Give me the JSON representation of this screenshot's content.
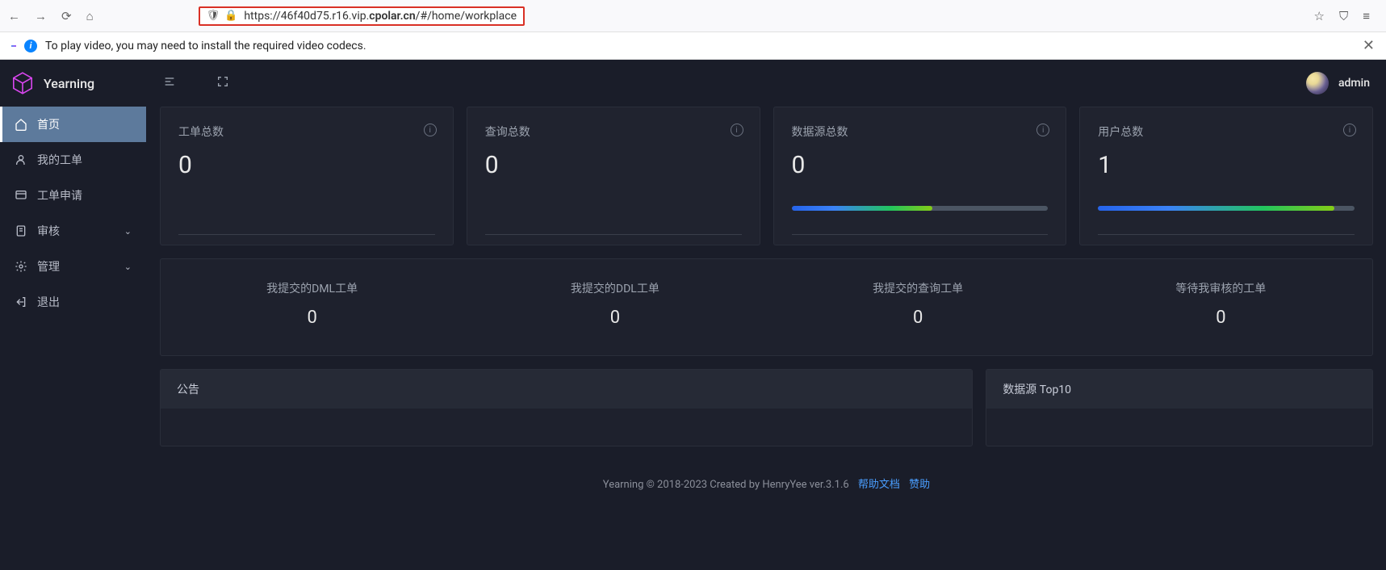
{
  "browser": {
    "url_prefix": "https://46f40d75.r16.vip.",
    "url_bold": "cpolar.cn",
    "url_suffix": "/#/home/workplace",
    "notification": "To play video, you may need to install the required video codecs."
  },
  "app": {
    "name": "Yearning",
    "username": "admin"
  },
  "sidebar": {
    "items": [
      {
        "label": "首页",
        "icon": "home",
        "active": true
      },
      {
        "label": "我的工单",
        "icon": "user",
        "active": false
      },
      {
        "label": "工单申请",
        "icon": "terminal",
        "active": false
      },
      {
        "label": "审核",
        "icon": "clipboard",
        "active": false,
        "expandable": true
      },
      {
        "label": "管理",
        "icon": "gear",
        "active": false,
        "expandable": true
      },
      {
        "label": "退出",
        "icon": "logout",
        "active": false
      }
    ]
  },
  "stats": [
    {
      "title": "工单总数",
      "value": "0",
      "has_bar": false
    },
    {
      "title": "查询总数",
      "value": "0",
      "has_bar": false
    },
    {
      "title": "数据源总数",
      "value": "0",
      "has_bar": true,
      "bar_pct": 55
    },
    {
      "title": "用户总数",
      "value": "1",
      "has_bar": true,
      "bar_pct": 92
    }
  ],
  "substats": [
    {
      "label": "我提交的DML工单",
      "value": "0"
    },
    {
      "label": "我提交的DDL工单",
      "value": "0"
    },
    {
      "label": "我提交的查询工单",
      "value": "0"
    },
    {
      "label": "等待我审核的工单",
      "value": "0"
    }
  ],
  "panels": {
    "announce": "公告",
    "top10": "数据源 Top10"
  },
  "footer": {
    "text": "Yearning © 2018-2023 Created by HenryYee ver.3.1.6",
    "link1": "帮助文档",
    "link2": "赞助"
  }
}
